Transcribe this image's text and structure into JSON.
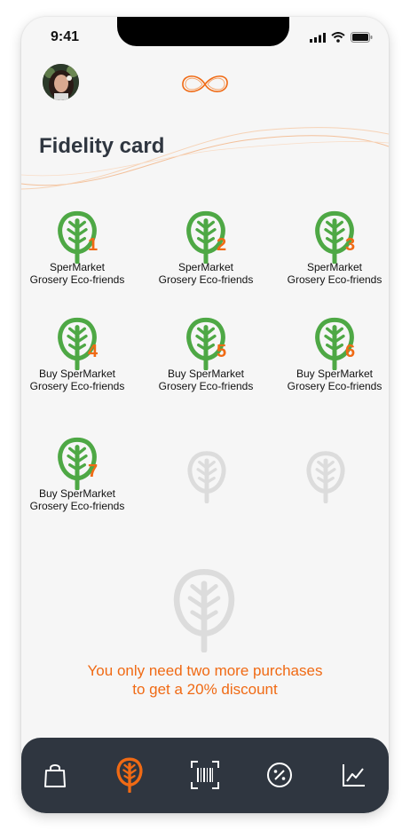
{
  "status_bar": {
    "time": "9:41"
  },
  "header": {
    "title": "Fidelity card"
  },
  "stamps": [
    {
      "number": "1",
      "line1": "SperMarket",
      "line2": "Grosery Eco-friends"
    },
    {
      "number": "2",
      "line1": "SperMarket",
      "line2": "Grosery Eco-friends"
    },
    {
      "number": "3",
      "line1": "SperMarket",
      "line2": "Grosery Eco-friends"
    },
    {
      "number": "4",
      "line1": "Buy SperMarket",
      "line2": "Grosery Eco-friends"
    },
    {
      "number": "5",
      "line1": "Buy SperMarket",
      "line2": "Grosery Eco-friends"
    },
    {
      "number": "6",
      "line1": "Buy SperMarket",
      "line2": "Grosery Eco-friends"
    },
    {
      "number": "7",
      "line1": "Buy SperMarket",
      "line2": "Grosery Eco-friends"
    }
  ],
  "empty_stamp_count": 2,
  "message": {
    "line1": "You only need two more purchases",
    "line2": "to get a 20% discount"
  },
  "tabbar": {
    "items": [
      "bag-icon",
      "leaf-icon",
      "barcode-icon",
      "percent-icon",
      "chart-icon"
    ],
    "active": "leaf-icon"
  },
  "colors": {
    "accent": "#f06a14",
    "leaf_active": "#4ea845",
    "leaf_empty": "#dcdcdc",
    "tabbar": "#2f3640",
    "title": "#2f3640"
  }
}
